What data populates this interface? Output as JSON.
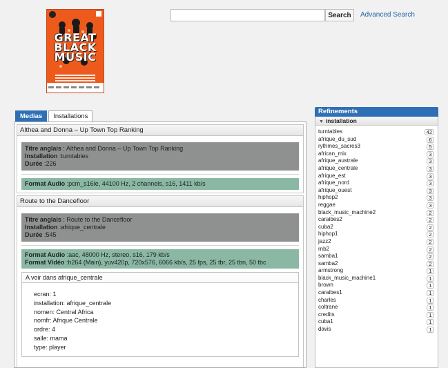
{
  "poster": {
    "title_lines": [
      "GREAT",
      "BLACK",
      "MUSIC"
    ]
  },
  "search": {
    "value": "",
    "button_label": "Search",
    "advanced_label": "Advanced Search"
  },
  "tabs": [
    {
      "label": "Medias",
      "active": true
    },
    {
      "label": "Installations",
      "active": false
    }
  ],
  "medias": [
    {
      "title": "Althea and Donna – Up Town Top Ranking",
      "titre_label": "Titre anglais",
      "titre_value": " : Althea and Donna – Up Town Top Ranking",
      "installation_label": "Installation",
      "installation_value": " :turntables",
      "duree_label": "Durée",
      "duree_value": " :226",
      "audio_label": "Format Audio",
      "audio_value": " :pcm_s16le, 44100 Hz, 2 channels, s16, 1411 kb/s"
    },
    {
      "title": "Route to the Dancefloor",
      "titre_label": "Titre anglais",
      "titre_value": " : Route to the Dancefloor",
      "installation_label": "Installation",
      "installation_value": " :afrique_centrale",
      "duree_label": "Durée",
      "duree_value": " :545",
      "audio_label": "Format Audio",
      "audio_value": " :aac, 48000 Hz, stereo, s16, 179 kb/s",
      "video_label": "Format Vidéo",
      "video_value": " :h264 (Main), yuv420p, 720x576, 6066 kb/s, 25 fps, 25 tbr, 25 tbn, 50 tbc",
      "voir": {
        "heading": "A voir dans afrique_centrale",
        "lines": [
          "ecran:  1",
          "installation:  afrique_centrale",
          "nomen:  Central Africa",
          "nomfr:  Afrique Centrale",
          "ordre:  4",
          "salle:  mama",
          "type:  player"
        ]
      }
    }
  ],
  "refinements": {
    "title": "Refinements",
    "section": "installation",
    "items": [
      {
        "name": "turntables",
        "count": "42"
      },
      {
        "name": "afrique_du_sud",
        "count": "6"
      },
      {
        "name": "rythmes_sacres3",
        "count": "5"
      },
      {
        "name": "african_mix",
        "count": "3"
      },
      {
        "name": "afrique_australe",
        "count": "3"
      },
      {
        "name": "afrique_centrale",
        "count": "3"
      },
      {
        "name": "afrique_est",
        "count": "3"
      },
      {
        "name": "afrique_nord",
        "count": "3"
      },
      {
        "name": "afrique_ouest",
        "count": "3"
      },
      {
        "name": "hiphop2",
        "count": "3"
      },
      {
        "name": "reggae",
        "count": "3"
      },
      {
        "name": "black_music_machine2",
        "count": "2"
      },
      {
        "name": "caraibes2",
        "count": "2"
      },
      {
        "name": "cuba2",
        "count": "2"
      },
      {
        "name": "hiphop1",
        "count": "2"
      },
      {
        "name": "jazz2",
        "count": "2"
      },
      {
        "name": "rnb2",
        "count": "2"
      },
      {
        "name": "samba1",
        "count": "2"
      },
      {
        "name": "samba2",
        "count": "2"
      },
      {
        "name": "armstrong",
        "count": "1"
      },
      {
        "name": "black_music_machine1",
        "count": "1"
      },
      {
        "name": "brown",
        "count": "1"
      },
      {
        "name": "caraibes1",
        "count": "1"
      },
      {
        "name": "charles",
        "count": "1"
      },
      {
        "name": "coltrane",
        "count": "1"
      },
      {
        "name": "credits",
        "count": "1"
      },
      {
        "name": "cuba1",
        "count": "1"
      },
      {
        "name": "davis",
        "count": "1"
      }
    ]
  }
}
